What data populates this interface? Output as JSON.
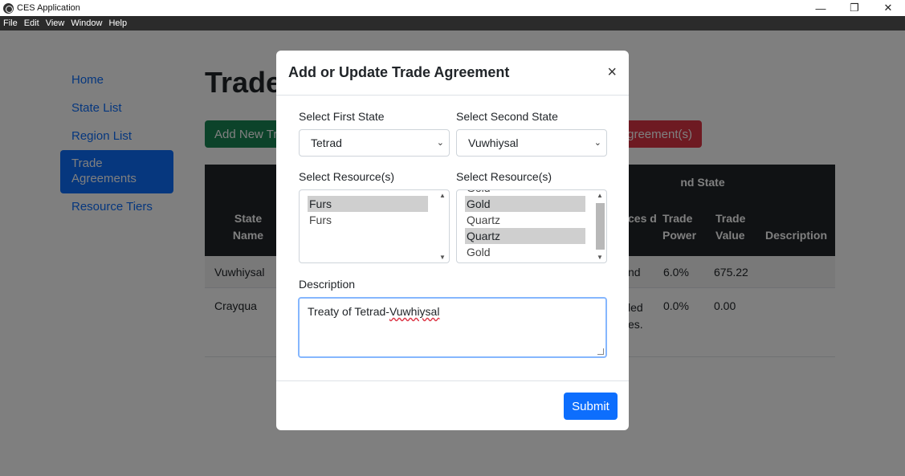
{
  "window": {
    "title": "CES Application",
    "controls": {
      "minimize": "—",
      "restore": "❐",
      "close": "✕"
    },
    "menu": [
      "File",
      "Edit",
      "View",
      "Window",
      "Help"
    ]
  },
  "sidebar": {
    "items": [
      {
        "label": "Home",
        "active": false
      },
      {
        "label": "State List",
        "active": false
      },
      {
        "label": "Region List",
        "active": false
      },
      {
        "label": "Trade Agreements",
        "active": true
      },
      {
        "label": "Resource Tiers",
        "active": false
      }
    ]
  },
  "page": {
    "title": "Trade",
    "add_button": "Add New Tra",
    "delete_button": "Agreement(s)"
  },
  "table": {
    "group_header": "nd State",
    "columns": {
      "state_name": "State Name",
      "resources_traded": "ces d",
      "trade_power": "Trade Power",
      "trade_value": "Trade Value",
      "description": "Description"
    },
    "rows": [
      {
        "state_name": "Vuwhiysal",
        "resources": "nd",
        "trade_power": "6.0%",
        "trade_value": "675.22",
        "description": ""
      },
      {
        "state_name": "Crayqua",
        "resources": "led\nes.",
        "trade_power": "0.0%",
        "trade_value": "0.00",
        "description": ""
      }
    ]
  },
  "modal": {
    "title": "Add or Update Trade Agreement",
    "close": "×",
    "first_state_label": "Select First State",
    "first_state_value": "Tetrad",
    "second_state_label": "Select Second State",
    "second_state_value": "Vuwhiysal",
    "first_resources_label": "Select Resource(s)",
    "first_resources": [
      {
        "label": "Furs",
        "selected": true
      },
      {
        "label": "Furs",
        "selected": false
      }
    ],
    "second_resources_label": "Select Resource(s)",
    "second_resources": [
      {
        "label": "Gold",
        "selected": false
      },
      {
        "label": "Gold",
        "selected": true
      },
      {
        "label": "Quartz",
        "selected": false
      },
      {
        "label": "Quartz",
        "selected": true
      },
      {
        "label": "Gold",
        "selected": false
      }
    ],
    "description_label": "Description",
    "description_prefix": "Treaty of Tetrad-",
    "description_misspelled": "Vuwhiysal",
    "submit": "Submit"
  },
  "colors": {
    "primary": "#0d6efd",
    "success": "#198754",
    "danger": "#dc3545",
    "dark": "#212529"
  }
}
